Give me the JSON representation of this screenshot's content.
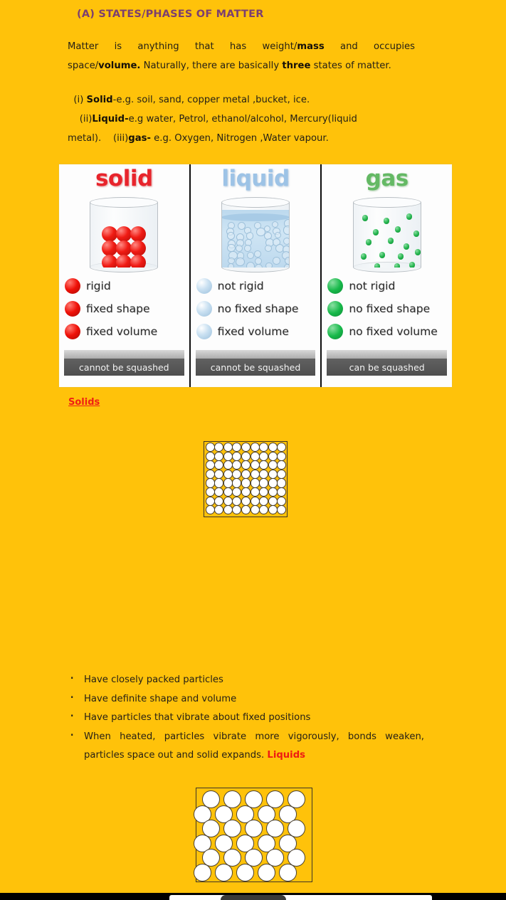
{
  "page": {
    "background_color": "#FFC20A",
    "title": "(A) STATES/PHASES OF MATTER",
    "title_color": "#7C3F70"
  },
  "paragraphs": {
    "matter_line1": "Matter is anything that has weight/",
    "matter_bold1": "mass",
    "matter_line1b": " and occupies",
    "matter_line2a": "space/",
    "matter_bold2": "volume.",
    "matter_line2b": " Naturally, there are basically ",
    "matter_bold3": "three",
    "matter_line2c": " states of matter."
  },
  "examples": {
    "solid_marker": "(i) ",
    "solid_label": "Solid",
    "solid_text": "-e.g. soil, sand, copper metal ,bucket, ice.",
    "liquid_marker": "(ii)",
    "liquid_label": "Liquid-",
    "liquid_text": "e.g water, Petrol, ethanol/alcohol, Mercury(liquid",
    "liquid_cont": "metal).    ",
    "gas_marker": "(iii)",
    "gas_label": "gas-",
    "gas_text": " e.g. Oxygen, Nitrogen ,Water vapour."
  },
  "figure": {
    "panels": [
      {
        "title": "solid",
        "title_color": "#e8242c",
        "bead_color": "#ef1108",
        "properties": [
          "rigid",
          "fixed shape",
          "fixed volume"
        ],
        "slab_label": "cannot be squashed"
      },
      {
        "title": "liquid",
        "title_color": "#9dc3e6",
        "bead_color": "#9cc0dc",
        "properties": [
          "not rigid",
          "no fixed shape",
          "fixed volume"
        ],
        "slab_label": "cannot be squashed"
      },
      {
        "title": "gas",
        "title_color": "#64b964",
        "bead_color": "#17b94a",
        "properties": [
          "not rigid",
          "no fixed shape",
          "no fixed volume"
        ],
        "slab_label": "can be squashed"
      }
    ]
  },
  "sections": {
    "solids_heading": "Solids",
    "liquids_heading": "Liquids"
  },
  "solid_bullets": {
    "b1": "Have closely packed particles",
    "b2": "Have definite shape and volume",
    "b3": "Have particles that vibrate about fixed positions",
    "b4_line1": "When heated, particles vibrate more vigorously, bonds weaken,",
    "b4_line2": "particles space out and solid expands.  "
  },
  "diagrams": {
    "solid_lattice": {
      "columns": 9,
      "rows": 8,
      "particle_fill": "#ffffff"
    },
    "liquid_lattice": {
      "rows": 6,
      "per_row": 5,
      "particle_fill": "#ffffff"
    }
  }
}
